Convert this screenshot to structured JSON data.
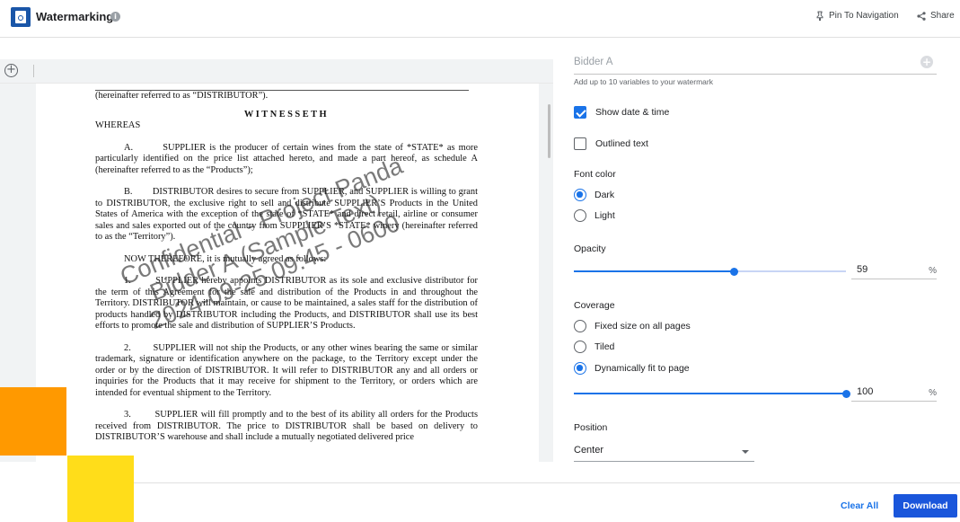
{
  "header": {
    "title": "Watermarking",
    "info_icon": "info-icon",
    "pin_label": "Pin To Navigation",
    "share_label": "Share"
  },
  "document": {
    "lines": {
      "l0": "(hereinafter referred to as “DISTRIBUTOR”).",
      "witnesseth": "WITNESSETH",
      "whereas": "WHEREAS"
    },
    "paragraphs": [
      "A.        SUPPLIER is the producer of certain wines from the state of *STATE* as more particularly identified on the price list attached hereto, and made a part hereof, as schedule A (hereinafter referred to as the “Products”);",
      "B.        DISTRIBUTOR desires to secure from SUPPLIER, and SUPPLIER is willing to grant to DISTRIBUTOR, the exclusive right to sell and distribute SUPPLIER’S Products in the United States of America with the exception of the state of *STATE* and direct retail, airline or consumer sales and sales exported out of the country from SUPPLIER’S *STATE* winery (hereinafter referred to as the “Territory”).",
      "NOW THEREFORE, it is mutually agreed as follows:",
      "1.        SUPPLIER hereby appoints DISTRIBUTOR as its sole and exclusive distributor for the term of this Agreement for the sale and distribution of the Products in and throughout the Territory. DISTRIBUTOR will maintain, or cause to be maintained, a sales staff for the distribution of products handled by DISTRIBUTOR including the Products, and DISTRIBUTOR shall use its best efforts to promote the sale and distribution of SUPPLIER’S Products.",
      "2.        SUPPLIER will not ship the Products, or any other wines bearing the same or similar trademark, signature or identification anywhere on the package, to the Territory except under the order or by the direction of DISTRIBUTOR. It will refer to DISTRIBUTOR any and all orders or inquiries for the Products that it may receive for shipment to the Territory, or orders which are intended for eventual shipment to the Territory.",
      "3.        SUPPLIER will fill promptly and to the best of its ability all orders for the Products received from DISTRIBUTOR. The price to DISTRIBUTOR shall be based on delivery to DISTRIBUTOR’S warehouse and shall include a mutually negotiated delivered price"
    ],
    "watermark_lines": [
      "Confidential - Project Panda",
      "Bidder A (Sample Text)",
      "2024-09-25 09:45 - 0600"
    ]
  },
  "panel": {
    "variable_input": {
      "value": "Bidder A",
      "add_icon": "plus-circle-icon",
      "helper": "Add up to 10 variables to your watermark"
    },
    "show_datetime": {
      "label": "Show date & time",
      "checked": true
    },
    "outlined_text": {
      "label": "Outlined text",
      "checked": false
    },
    "font_color": {
      "label": "Font color",
      "options": [
        "Dark",
        "Light"
      ],
      "selected": "Dark"
    },
    "opacity": {
      "label": "Opacity",
      "value": "59",
      "unit": "%",
      "fraction": 0.59
    },
    "coverage": {
      "label": "Coverage",
      "options": [
        "Fixed size on all pages",
        "Tiled",
        "Dynamically fit to page"
      ],
      "selected": "Dynamically fit to page",
      "value": "100",
      "unit": "%",
      "fraction": 1.0
    },
    "position": {
      "label": "Position",
      "value": "Center"
    }
  },
  "footer": {
    "clear_label": "Clear All",
    "download_label": "Download"
  },
  "colors": {
    "accent": "#1a73e8",
    "download": "#1a56db",
    "logo": "#1a56a8",
    "orange": "#ff9900",
    "yellow": "#ffdd1a"
  }
}
